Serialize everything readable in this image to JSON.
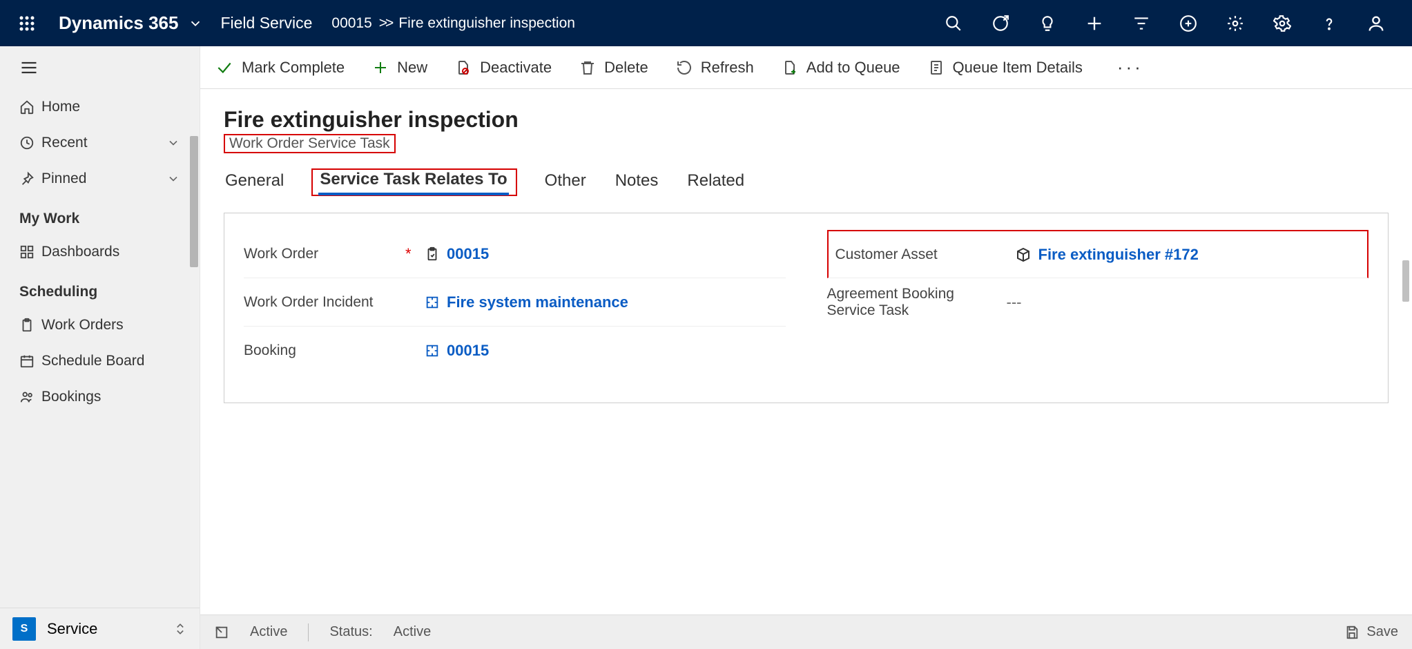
{
  "topbar": {
    "brand": "Dynamics 365",
    "app": "Field Service",
    "breadcrumb_id": "00015",
    "breadcrumb_name": "Fire extinguisher inspection"
  },
  "sidebar": {
    "home": "Home",
    "recent": "Recent",
    "pinned": "Pinned",
    "group_mywork": "My Work",
    "dashboards": "Dashboards",
    "group_scheduling": "Scheduling",
    "workorders": "Work Orders",
    "scheduleboard": "Schedule Board",
    "bookings": "Bookings",
    "area_initial": "S",
    "area_label": "Service"
  },
  "commands": {
    "mark_complete": "Mark Complete",
    "new": "New",
    "deactivate": "Deactivate",
    "delete": "Delete",
    "refresh": "Refresh",
    "add_to_queue": "Add to Queue",
    "queue_item_details": "Queue Item Details"
  },
  "page": {
    "title": "Fire extinguisher inspection",
    "subtitle": "Work Order Service Task"
  },
  "tabs": {
    "general": "General",
    "relates": "Service Task Relates To",
    "other": "Other",
    "notes": "Notes",
    "related": "Related"
  },
  "fields": {
    "work_order_label": "Work Order",
    "work_order_value": "00015",
    "incident_label": "Work Order Incident",
    "incident_value": "Fire system maintenance",
    "booking_label": "Booking",
    "booking_value": "00015",
    "asset_label": "Customer Asset",
    "asset_value": "Fire extinguisher #172",
    "agreement_label": "Agreement Booking Service Task",
    "agreement_value": "---"
  },
  "status": {
    "state": "Active",
    "status_label": "Status:",
    "status_value": "Active",
    "save": "Save"
  }
}
